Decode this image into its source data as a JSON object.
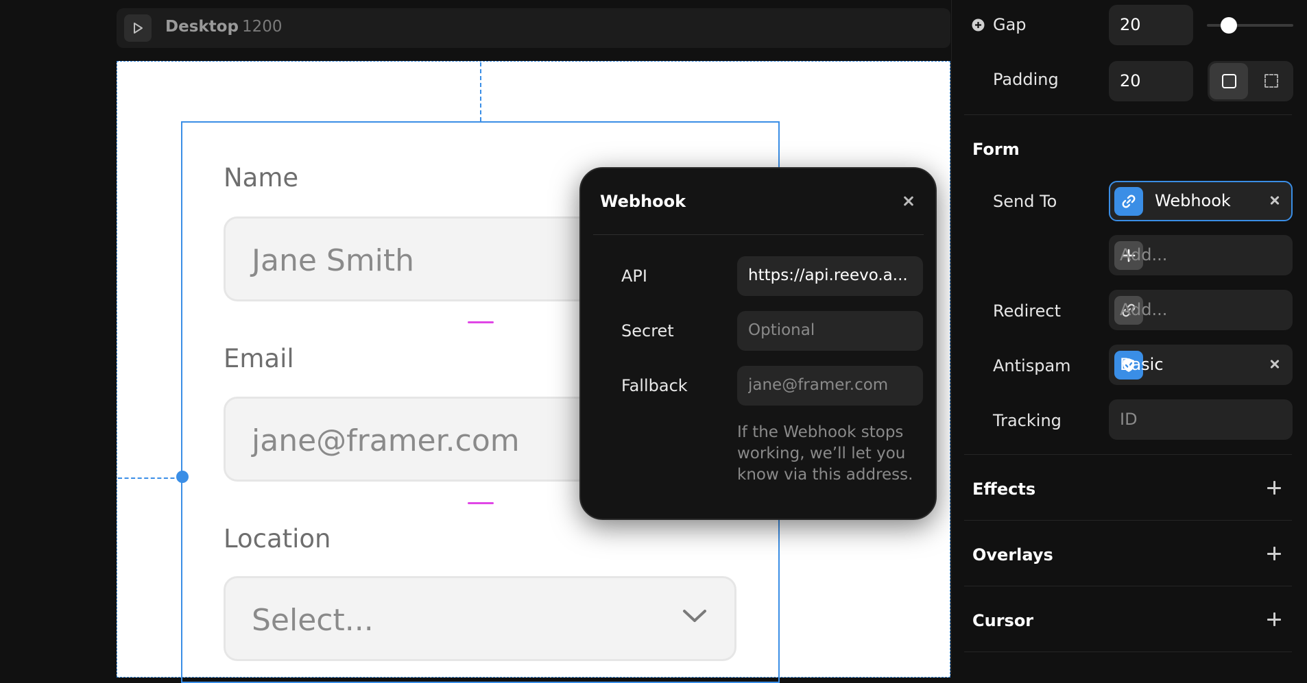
{
  "toolbar": {
    "breakpoint_name": "Desktop",
    "breakpoint_width": "1200"
  },
  "form_preview": {
    "name_label": "Name",
    "name_placeholder": "Jane Smith",
    "email_label": "Email",
    "email_placeholder": "jane@framer.com",
    "location_label": "Location",
    "location_placeholder": "Select..."
  },
  "webhook_popover": {
    "title": "Webhook",
    "api_label": "API",
    "api_value": "https://api.reevo.a...",
    "secret_label": "Secret",
    "secret_placeholder": "Optional",
    "fallback_label": "Fallback",
    "fallback_placeholder": "jane@framer.com",
    "hint": "If the Webhook stops working, we’ll let you know via this address."
  },
  "panel": {
    "gap_label": "Gap",
    "gap_value": "20",
    "padding_label": "Padding",
    "padding_value": "20",
    "form_section": "Form",
    "send_to_label": "Send To",
    "send_to_value": "Webhook",
    "add_placeholder": "Add...",
    "redirect_label": "Redirect",
    "redirect_placeholder": "Add...",
    "antispam_label": "Antispam",
    "antispam_value": "Basic",
    "tracking_label": "Tracking",
    "tracking_placeholder": "ID",
    "effects_section": "Effects",
    "overlays_section": "Overlays",
    "cursor_section": "Cursor"
  },
  "colors": {
    "accent": "#3a8ee6",
    "gap_indicator": "#e046e6",
    "chip_blue": "#3a8ee6"
  }
}
